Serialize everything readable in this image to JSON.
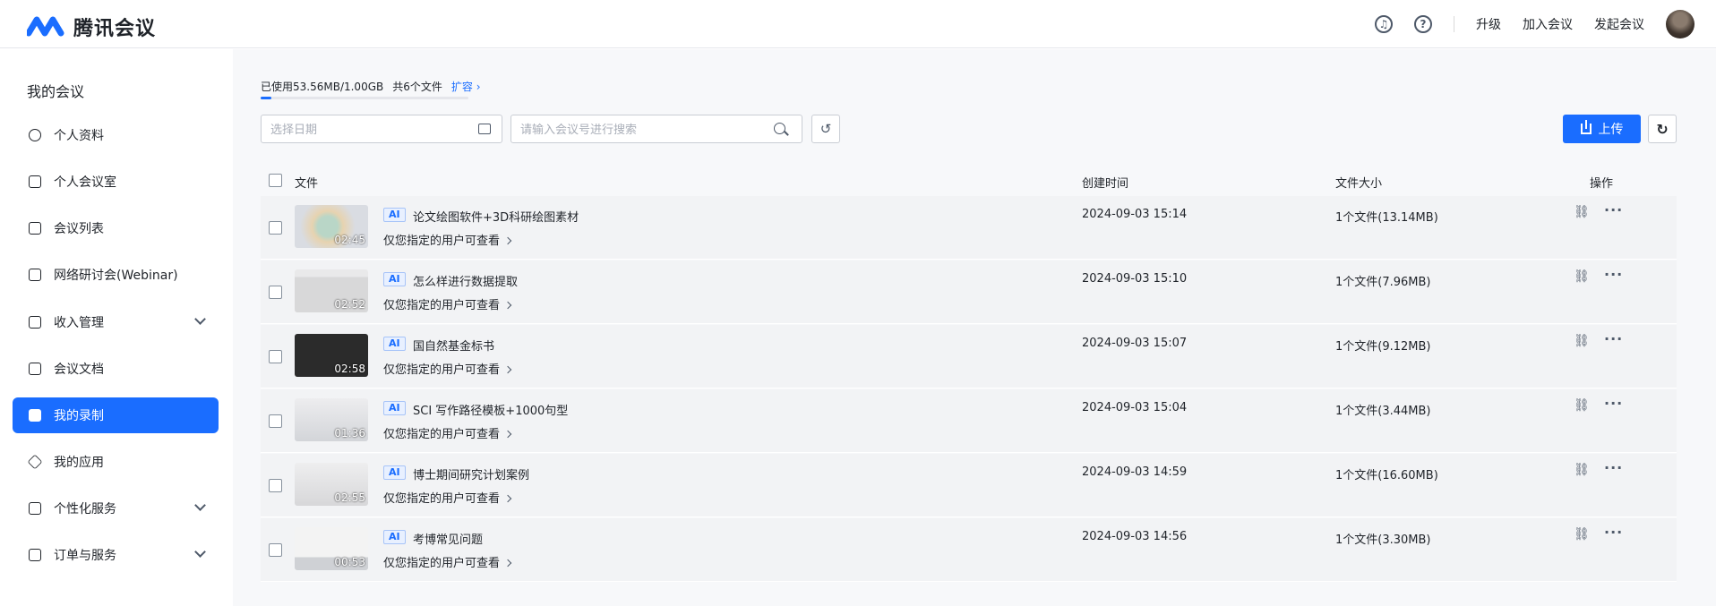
{
  "header": {
    "app_name": "腾讯会议",
    "links": [
      "升级",
      "加入会议",
      "发起会议"
    ],
    "icons": [
      "headset-icon",
      "help-icon"
    ]
  },
  "sidebar": {
    "title": "我的会议",
    "items": [
      {
        "label": "个人资料",
        "icon": "user-icon"
      },
      {
        "label": "个人会议室",
        "icon": "meeting-room-icon"
      },
      {
        "label": "会议列表",
        "icon": "list-icon"
      },
      {
        "label": "网络研讨会(Webinar)",
        "icon": "webinar-icon"
      },
      {
        "label": "收入管理",
        "icon": "wallet-icon"
      },
      {
        "label": "会议文档",
        "icon": "document-icon"
      },
      {
        "label": "我的录制",
        "icon": "recording-icon"
      },
      {
        "label": "我的应用",
        "icon": "apps-icon"
      },
      {
        "label": "个性化服务",
        "icon": "personalize-icon"
      },
      {
        "label": "订单与服务",
        "icon": "order-icon"
      }
    ],
    "active_index": 6
  },
  "toolbar": {
    "usage_text": "已使用53.56MB/1.00GB",
    "file_count": "共6个文件",
    "expand_label": "扩容",
    "usage_fraction": 0.052,
    "date_placeholder": "选择日期",
    "search_placeholder": "请输入会议号进行搜索",
    "upload_label": "上传"
  },
  "table": {
    "columns": [
      "文件",
      "创建时间",
      "文件大小",
      "操作"
    ],
    "rows": [
      {
        "title": "论文绘图软件+3D科研绘图素材",
        "duration": "02:45",
        "permission": "仅您指定的用户可查看",
        "created": "2024-09-03 15:14",
        "size": "1个文件(13.14MB)"
      },
      {
        "title": "怎么样进行数据提取",
        "duration": "02:52",
        "permission": "仅您指定的用户可查看",
        "created": "2024-09-03 15:10",
        "size": "1个文件(7.96MB)"
      },
      {
        "title": "国自然基金标书",
        "duration": "02:58",
        "permission": "仅您指定的用户可查看",
        "created": "2024-09-03 15:07",
        "size": "1个文件(9.12MB)"
      },
      {
        "title": "SCI 写作路径模板+1000句型",
        "duration": "01:36",
        "permission": "仅您指定的用户可查看",
        "created": "2024-09-03 15:04",
        "size": "1个文件(3.44MB)"
      },
      {
        "title": "博士期间研究计划案例",
        "duration": "02:55",
        "permission": "仅您指定的用户可查看",
        "created": "2024-09-03 14:59",
        "size": "1个文件(16.60MB)"
      },
      {
        "title": "考博常见问题",
        "duration": "00:53",
        "permission": "仅您指定的用户可查看",
        "created": "2024-09-03 14:56",
        "size": "1个文件(3.30MB)"
      }
    ],
    "ai_badge": "AI"
  },
  "colors": {
    "accent": "#1a6dff",
    "background": "#f7f8fa",
    "row_background": "#f2f3f5"
  }
}
